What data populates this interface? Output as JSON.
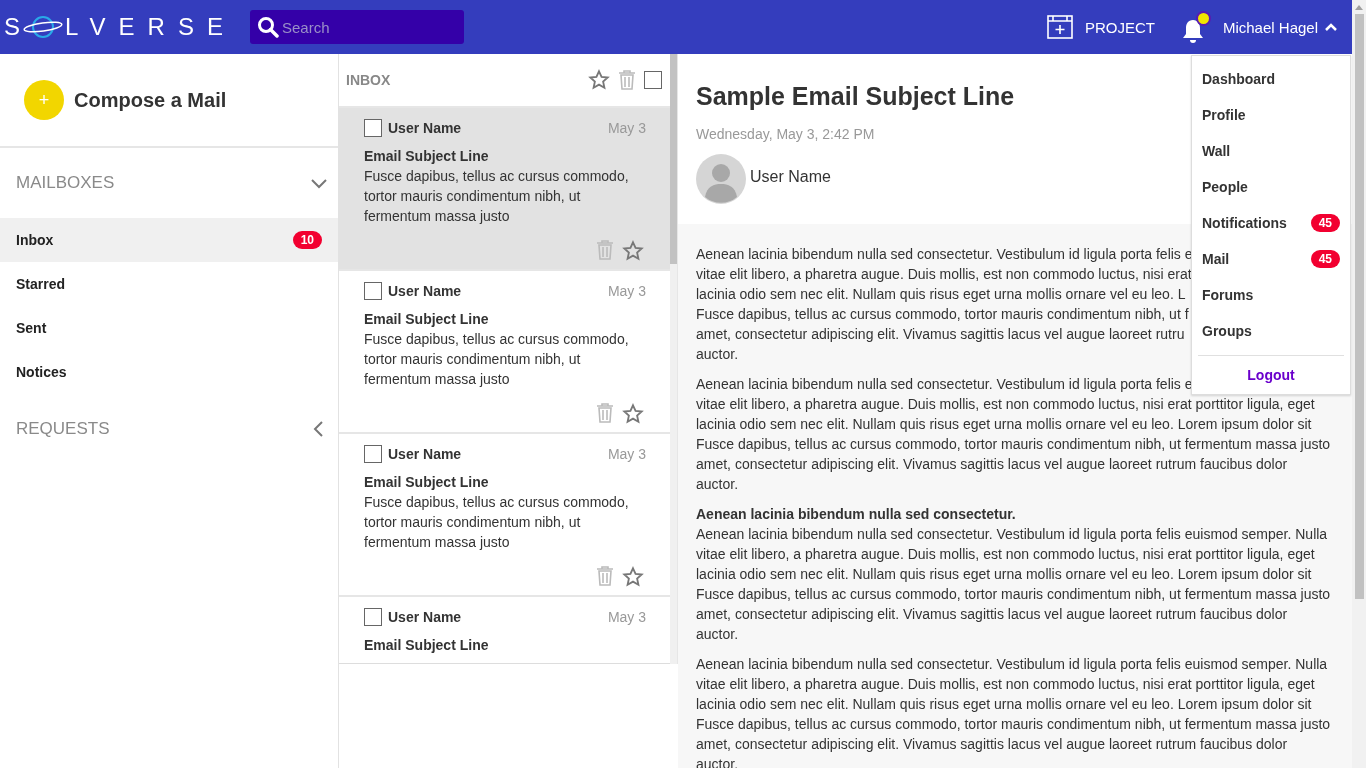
{
  "header": {
    "logo": {
      "start": "S",
      "end": "LVERSE"
    },
    "search": {
      "placeholder": "Search"
    },
    "project": {
      "label": "PROJECT"
    },
    "notifications": {
      "alert": true
    },
    "user": {
      "name": "Michael Hagel",
      "expanded": true
    }
  },
  "user_menu": {
    "items": [
      {
        "label": "Dashboard"
      },
      {
        "label": "Profile"
      },
      {
        "label": "Wall"
      },
      {
        "label": "People"
      },
      {
        "label": "Notifications",
        "badge": "45"
      },
      {
        "label": "Mail",
        "badge": "45"
      },
      {
        "label": "Forums"
      },
      {
        "label": "Groups"
      }
    ],
    "logout": "Logout"
  },
  "sidebar": {
    "compose": {
      "icon": "+",
      "label": "Compose a Mail"
    },
    "sections": [
      {
        "title": "MAILBOXES",
        "expanded": true,
        "items": [
          {
            "label": "Inbox",
            "selected": true,
            "badge": "10"
          },
          {
            "label": "Starred",
            "selected": false
          },
          {
            "label": "Sent",
            "selected": false
          },
          {
            "label": "Notices",
            "selected": false
          }
        ]
      },
      {
        "title": "REQUESTS",
        "expanded": false
      }
    ]
  },
  "inbox": {
    "title": "INBOX",
    "select_all": {
      "checked": false
    },
    "messages": [
      {
        "sender": "User Name",
        "date": "May 3",
        "subject": "Email Subject Line",
        "preview": "Fusce dapibus, tellus ac cursus commodo, tortor mauris condimentum nibh, ut fermentum massa justo",
        "selected": true,
        "checked": false,
        "starred": false
      },
      {
        "sender": "User Name",
        "date": "May 3",
        "subject": "Email Subject Line",
        "preview": "Fusce dapibus, tellus ac cursus commodo, tortor mauris condimentum nibh, ut fermentum massa justo",
        "selected": false,
        "checked": false,
        "starred": false
      },
      {
        "sender": "User Name",
        "date": "May 3",
        "subject": "Email Subject Line",
        "preview": "Fusce dapibus, tellus ac cursus commodo, tortor mauris condimentum nibh, ut fermentum massa justo",
        "selected": false,
        "checked": false,
        "starred": false
      },
      {
        "sender": "User Name",
        "date": "May 3",
        "subject": "Email Subject Line",
        "selected": false,
        "checked": false
      }
    ]
  },
  "message": {
    "subject": "Sample Email Subject Line",
    "date": "Wednesday, May 3, 2:42 PM",
    "sender": "User Name",
    "paragraphs": [
      {
        "lines": [
          "Aenean lacinia bibendum nulla sed consectetur. Vestibulum id ligula porta felis e",
          "vitae elit libero, a pharetra augue. Duis mollis, est non commodo luctus, nisi erat",
          "lacinia odio sem nec elit. Nullam quis risus eget urna mollis ornare vel eu leo. L",
          "Fusce dapibus, tellus ac cursus commodo, tortor mauris condimentum nibh, ut f",
          "amet, consectetur adipiscing elit. Vivamus sagittis lacus vel augue laoreet rutru",
          "auctor."
        ]
      },
      {
        "lines": [
          "Aenean lacinia bibendum nulla sed consectetur. Vestibulum id ligula porta felis e",
          "vitae elit libero, a pharetra augue. Duis mollis, est non commodo luctus, nisi erat porttitor ligula, eget",
          "lacinia odio sem nec elit. Nullam quis risus eget urna mollis ornare vel eu leo. Lorem ipsum dolor sit",
          "Fusce dapibus, tellus ac cursus commodo, tortor mauris condimentum nibh, ut fermentum massa justo",
          "amet, consectetur adipiscing elit. Vivamus sagittis lacus vel augue laoreet rutrum faucibus dolor",
          "auctor."
        ]
      },
      {
        "heading": "Aenean lacinia bibendum nulla sed consectetur.",
        "lines": [
          "Aenean lacinia bibendum nulla sed consectetur. Vestibulum id ligula porta felis euismod semper. Nulla",
          "vitae elit libero, a pharetra augue. Duis mollis, est non commodo luctus, nisi erat porttitor ligula, eget",
          "lacinia odio sem nec elit. Nullam quis risus eget urna mollis ornare vel eu leo. Lorem ipsum dolor sit",
          "Fusce dapibus, tellus ac cursus commodo, tortor mauris condimentum nibh, ut fermentum massa justo",
          "amet, consectetur adipiscing elit. Vivamus sagittis lacus vel augue laoreet rutrum faucibus dolor",
          "auctor."
        ]
      },
      {
        "lines": [
          "Aenean lacinia bibendum nulla sed consectetur. Vestibulum id ligula porta felis euismod semper. Nulla",
          "vitae elit libero, a pharetra augue. Duis mollis, est non commodo luctus, nisi erat porttitor ligula, eget",
          "lacinia odio sem nec elit. Nullam quis risus eget urna mollis ornare vel eu leo. Lorem ipsum dolor sit",
          "Fusce dapibus, tellus ac cursus commodo, tortor mauris condimentum nibh, ut fermentum massa justo",
          "amet, consectetur adipiscing elit. Vivamus sagittis lacus vel augue laoreet rutrum faucibus dolor",
          "auctor."
        ]
      }
    ]
  }
}
